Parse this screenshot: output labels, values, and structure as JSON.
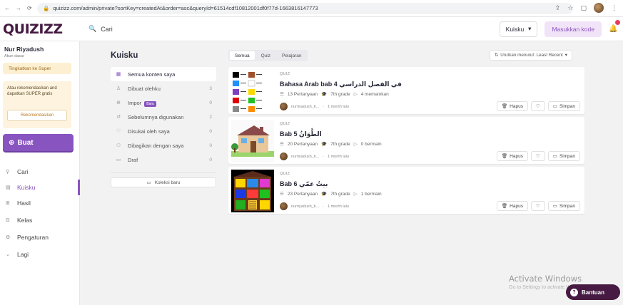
{
  "browser": {
    "url": "quizizz.com/admin/private?sortKey=createdAt&order=asc&queryId=61514cdf10812001df0f77d-1663816147773"
  },
  "appbar": {
    "logo": "QUIZIZZ",
    "search_placeholder": "Cari",
    "language": "Kuisku",
    "join_label": "Masukkan kode"
  },
  "sidebar": {
    "username": "Nur Riyadush",
    "usertype": "Akun dasar",
    "upgrade_label": "Tingkatkan ke Super",
    "promo_text": "Atau rekomendasikan and dapatkan SUPER gratis",
    "recommend_label": "Rekomendasikan",
    "create_label": "Buat",
    "nav": [
      {
        "label": "Cari"
      },
      {
        "label": "Kuisku"
      },
      {
        "label": "Hasil"
      },
      {
        "label": "Kelas"
      },
      {
        "label": "Pengaturan"
      },
      {
        "label": "Lagi"
      }
    ]
  },
  "main": {
    "title": "Kuisku",
    "filters": [
      {
        "label": "Semua konten saya",
        "count": ""
      },
      {
        "label": "Dibuat olehku",
        "count": "3"
      },
      {
        "label": "Impor",
        "count": "0",
        "badge": "Baru"
      },
      {
        "label": "Sebelumnya digunakan",
        "count": "2"
      },
      {
        "label": "Disukai oleh saya",
        "count": "0"
      },
      {
        "label": "Dibagikan dengan saya",
        "count": "0"
      },
      {
        "label": "Draf",
        "count": "0"
      }
    ],
    "new_collection": "Koleksi baru",
    "tabs": [
      "Semua",
      "Quiz",
      "Pelajaran"
    ],
    "sort_label": "Urutkan menurut: Least Recent"
  },
  "cards": [
    {
      "type": "QUIZ",
      "title": "Bahasa Arab bab 4 في الفصل الدراسي",
      "questions": "13 Pertanyaan",
      "grade": "7th grade",
      "plays": "4 memainkan",
      "author": "nurriyadush_ti...",
      "time": "1 month lalu",
      "delete_label": "Hapus",
      "save_label": "Simpan"
    },
    {
      "type": "QUIZ",
      "title": "Bab 5 الطَّوَانُ",
      "questions": "20 Pertanyaan",
      "grade": "7th grade",
      "plays": "0 bermain",
      "author": "nurriyadush_ti...",
      "time": "1 month lalu",
      "delete_label": "Hapus",
      "save_label": "Simpan"
    },
    {
      "type": "QUIZ",
      "title": "Bab 6 بيتُ عمّي",
      "questions": "23 Pertanyaan",
      "grade": "7th grade",
      "plays": "1 bermain",
      "author": "nurriyadush_ti...",
      "time": "1 month lalu",
      "delete_label": "Hapus",
      "save_label": "Simpan"
    }
  ],
  "overlay": {
    "activate_title": "Activate Windows",
    "activate_sub": "Go to Settings to activate Windows.",
    "help_label": "Bantuan"
  },
  "colors": {
    "accent": "#8854c0",
    "brand": "#461a42"
  }
}
